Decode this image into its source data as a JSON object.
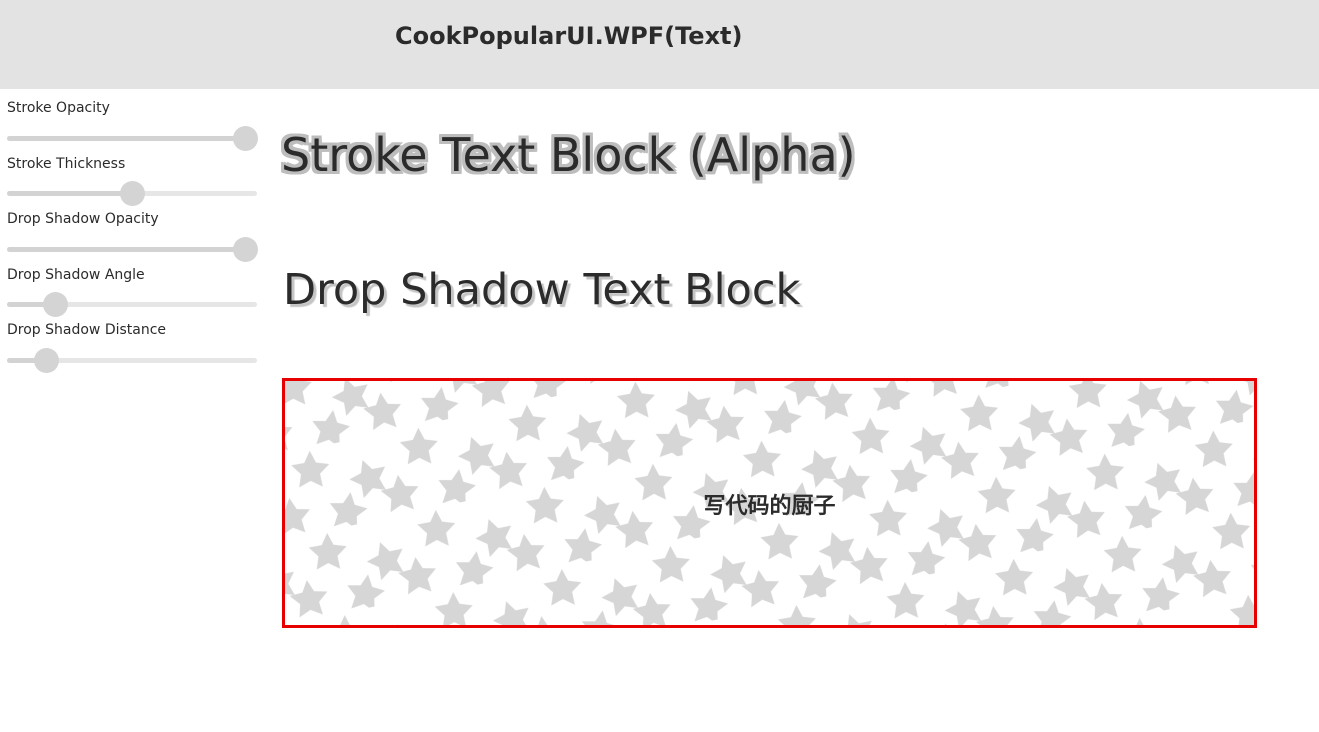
{
  "window": {
    "title": "CookPopularUI.WPF(Text)"
  },
  "sliders": [
    {
      "label": "Stroke Opacity",
      "value": 1.0
    },
    {
      "label": "Stroke Thickness",
      "value": 0.5
    },
    {
      "label": "Drop Shadow Opacity",
      "value": 1.0
    },
    {
      "label": "Drop Shadow Angle",
      "value": 0.16
    },
    {
      "label": "Drop Shadow Distance",
      "value": 0.12
    }
  ],
  "main": {
    "stroke_text": "Stroke Text Block (Alpha)",
    "shadow_text": "Drop Shadow Text Block",
    "pattern_text": "写代码的厨子"
  },
  "colors": {
    "titlebar_bg": "#e3e3e3",
    "border_accent": "#e60000",
    "star_fill": "#d6d6d6",
    "stroke_color": "#bdbdbd"
  },
  "icons": {
    "pattern": "star-icon"
  }
}
